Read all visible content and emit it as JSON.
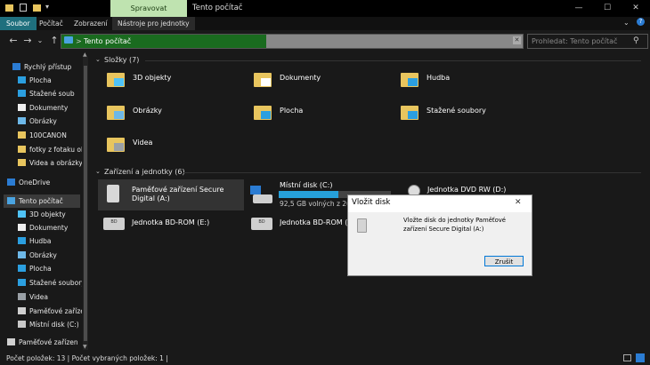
{
  "titlebar": {
    "manage_tab": "Spravovat",
    "title": "Tento počítač"
  },
  "ribbon": {
    "tabs": [
      "Soubor",
      "Počítač",
      "Zobrazení",
      "Nástroje pro jednotky"
    ]
  },
  "address": {
    "path": "Tento počítač",
    "separator": ">",
    "search_placeholder": "Prohledat: Tento počítač"
  },
  "nav": [
    {
      "label": "Rychlý přístup",
      "icon": "star-icon"
    },
    {
      "label": "Plocha",
      "icon": "desktop-icon"
    },
    {
      "label": "Stažené soub",
      "icon": "download-icon"
    },
    {
      "label": "Dokumenty",
      "icon": "document-icon"
    },
    {
      "label": "Obrázky",
      "icon": "pictures-icon"
    },
    {
      "label": "100CANON",
      "icon": "folder-icon"
    },
    {
      "label": "fotky z fotaku ol",
      "icon": "folder-icon"
    },
    {
      "label": "Videa a obrázky",
      "icon": "folder-icon"
    },
    {
      "label": "OneDrive",
      "icon": "cloud-icon"
    },
    {
      "label": "Tento počítač",
      "icon": "computer-icon"
    },
    {
      "label": "3D objekty",
      "icon": "cube-icon"
    },
    {
      "label": "Dokumenty",
      "icon": "document-icon"
    },
    {
      "label": "Hudba",
      "icon": "music-icon"
    },
    {
      "label": "Obrázky",
      "icon": "pictures-icon"
    },
    {
      "label": "Plocha",
      "icon": "desktop-icon"
    },
    {
      "label": "Stažené soubory",
      "icon": "download-icon"
    },
    {
      "label": "Videa",
      "icon": "video-icon"
    },
    {
      "label": "Paměťové zaříze",
      "icon": "sd-card-icon"
    },
    {
      "label": "Místní disk (C:)",
      "icon": "drive-icon"
    },
    {
      "label": "Paměťové zařízen",
      "icon": "sd-card-icon"
    }
  ],
  "folders_header": "Složky (7)",
  "folders": [
    "3D objekty",
    "Dokumenty",
    "Hudba",
    "Obrázky",
    "Plocha",
    "Stažené soubory",
    "Videa"
  ],
  "devices_header": "Zařízení a jednotky (6)",
  "devices": [
    {
      "name": "Paměťové zařízení Secure Digital (A:)"
    },
    {
      "name": "Místní disk (C:)",
      "free": "92,5 GB volných z 202",
      "used_fraction": 0.53
    },
    {
      "name": "Jednotka DVD RW (D:)"
    },
    {
      "name": "Jednotka BD-ROM (E:)"
    },
    {
      "name": "Jednotka BD-ROM (F:)"
    }
  ],
  "dialog": {
    "title": "Vložit disk",
    "message": "Vložte disk do jednotky Paměťové zařízení Secure Digital (A:)",
    "cancel": "Zrušit"
  },
  "status": {
    "text": "Počet položek: 13  |  Počet vybraných položek: 1  |"
  }
}
